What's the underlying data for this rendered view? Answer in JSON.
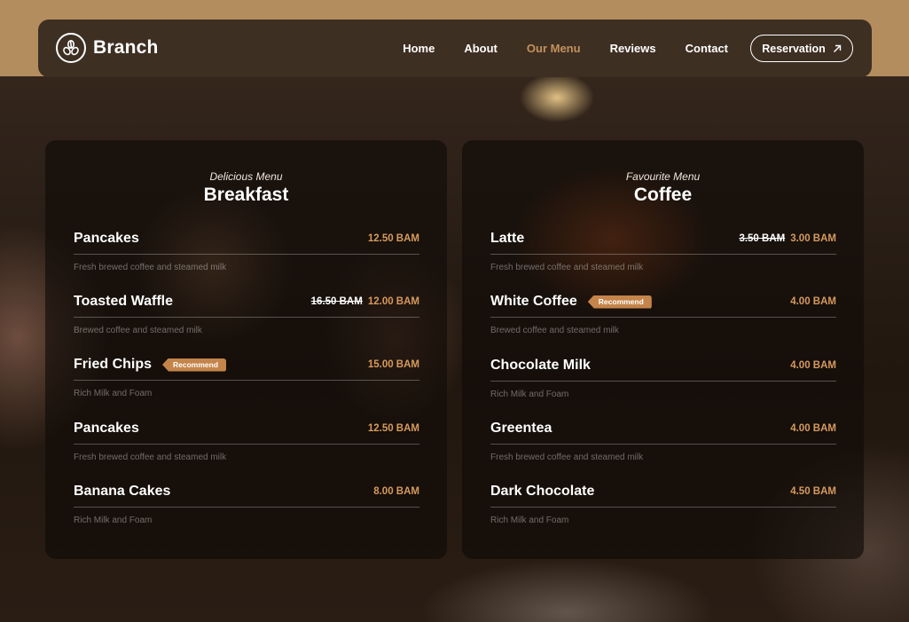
{
  "brand": {
    "name": "Branch"
  },
  "nav": {
    "links": [
      "Home",
      "About",
      "Our Menu",
      "Reviews",
      "Contact"
    ],
    "active": "Our Menu",
    "cta_label": "Reservation"
  },
  "colors": {
    "accent": "#c4925c",
    "price": "#d69a5d",
    "badge": "#c4844a",
    "navbar": "#3e2f23",
    "band": "#b48d5f"
  },
  "icons": {
    "logo": "coffee-beans-icon",
    "cta": "arrow-up-right-icon"
  },
  "menus": [
    {
      "subtitle": "Delicious Menu",
      "title": "Breakfast",
      "items": [
        {
          "name": "Pancakes",
          "old_price": "",
          "price": "12.50 BAM",
          "badge": "",
          "desc": "Fresh brewed coffee and steamed milk"
        },
        {
          "name": "Toasted Waffle",
          "old_price": "16.50 BAM",
          "price": "12.00 BAM",
          "badge": "",
          "desc": "Brewed coffee and steamed milk"
        },
        {
          "name": "Fried Chips",
          "old_price": "",
          "price": "15.00 BAM",
          "badge": "Recommend",
          "desc": "Rich Milk and Foam"
        },
        {
          "name": "Pancakes",
          "old_price": "",
          "price": "12.50 BAM",
          "badge": "",
          "desc": "Fresh brewed coffee and steamed milk"
        },
        {
          "name": "Banana Cakes",
          "old_price": "",
          "price": "8.00 BAM",
          "badge": "",
          "desc": "Rich Milk and Foam"
        }
      ]
    },
    {
      "subtitle": "Favourite Menu",
      "title": "Coffee",
      "items": [
        {
          "name": "Latte",
          "old_price": "3.50 BAM",
          "price": "3.00 BAM",
          "badge": "",
          "desc": "Fresh brewed coffee and steamed milk"
        },
        {
          "name": "White Coffee",
          "old_price": "",
          "price": "4.00 BAM",
          "badge": "Recommend",
          "desc": "Brewed coffee and steamed milk"
        },
        {
          "name": "Chocolate Milk",
          "old_price": "",
          "price": "4.00 BAM",
          "badge": "",
          "desc": "Rich Milk and Foam"
        },
        {
          "name": "Greentea",
          "old_price": "",
          "price": "4.00 BAM",
          "badge": "",
          "desc": "Fresh brewed coffee and steamed milk"
        },
        {
          "name": "Dark Chocolate",
          "old_price": "",
          "price": "4.50 BAM",
          "badge": "",
          "desc": "Rich Milk and Foam"
        }
      ]
    }
  ]
}
